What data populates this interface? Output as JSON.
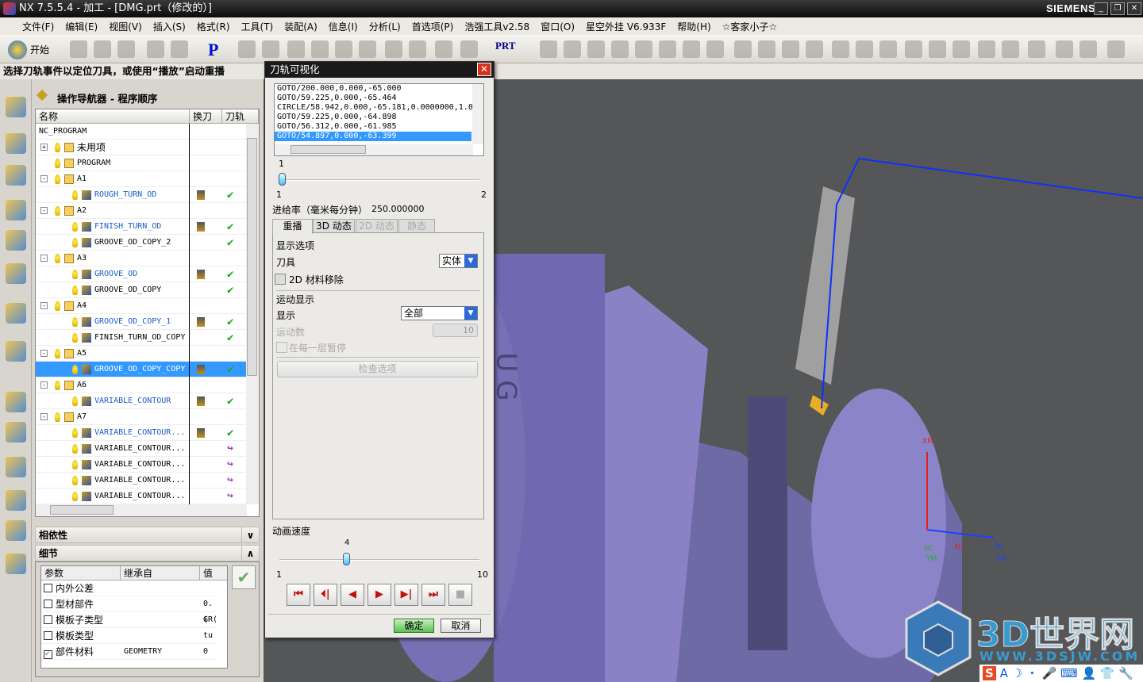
{
  "window": {
    "title": "NX 7.5.5.4 - 加工 - [DMG.prt（修改的）]",
    "brand": "SIEMENS"
  },
  "menu": [
    "文件(F)",
    "编辑(E)",
    "视图(V)",
    "插入(S)",
    "格式(R)",
    "工具(T)",
    "装配(A)",
    "信息(I)",
    "分析(L)",
    "首选项(P)",
    "浩强工具v2.58",
    "窗口(O)",
    "星空外挂 V6.933F",
    "帮助(H)",
    "☆客家小子☆"
  ],
  "toolbar": {
    "start_label": "开始",
    "prt_label": "PRT"
  },
  "cue": "选择刀轨事件以定位刀具，或使用“播放”启动重播",
  "navigator": {
    "title": "操作导航器 - 程序顺序",
    "columns": [
      "名称",
      "换刀",
      "刀轨"
    ],
    "rows": [
      {
        "name": "NC_PROGRAM",
        "level": 0,
        "type": "root"
      },
      {
        "name": "未用项",
        "level": 1,
        "type": "folder",
        "expander": "+"
      },
      {
        "name": "PROGRAM",
        "level": 1,
        "type": "folder"
      },
      {
        "name": "A1",
        "level": 1,
        "type": "folder",
        "expander": "-"
      },
      {
        "name": "ROUGH_TURN_OD",
        "level": 2,
        "type": "op",
        "blue": true,
        "tool": true,
        "status": "check"
      },
      {
        "name": "A2",
        "level": 1,
        "type": "folder",
        "expander": "-"
      },
      {
        "name": "FINISH_TURN_OD",
        "level": 2,
        "type": "op",
        "blue": true,
        "tool": true,
        "status": "check"
      },
      {
        "name": "GROOVE_OD_COPY_2",
        "level": 2,
        "type": "op",
        "status": "check"
      },
      {
        "name": "A3",
        "level": 1,
        "type": "folder",
        "expander": "-"
      },
      {
        "name": "GROOVE_OD",
        "level": 2,
        "type": "op",
        "blue": true,
        "tool": true,
        "status": "check"
      },
      {
        "name": "GROOVE_OD_COPY",
        "level": 2,
        "type": "op",
        "status": "check"
      },
      {
        "name": "A4",
        "level": 1,
        "type": "folder",
        "expander": "-"
      },
      {
        "name": "GROOVE_OD_COPY_1",
        "level": 2,
        "type": "op",
        "blue": true,
        "tool": true,
        "status": "check"
      },
      {
        "name": "FINISH_TURN_OD_COPY",
        "level": 2,
        "type": "op",
        "status": "check"
      },
      {
        "name": "A5",
        "level": 1,
        "type": "folder",
        "expander": "-"
      },
      {
        "name": "GROOVE_OD_COPY_COPY",
        "level": 2,
        "type": "op",
        "selected": true,
        "tool": true,
        "status": "check"
      },
      {
        "name": "A6",
        "level": 1,
        "type": "folder",
        "expander": "-"
      },
      {
        "name": "VARIABLE_CONTOUR",
        "level": 2,
        "type": "op",
        "blue": true,
        "tool": true,
        "status": "check"
      },
      {
        "name": "A7",
        "level": 1,
        "type": "folder",
        "expander": "-"
      },
      {
        "name": "VARIABLE_CONTOUR...",
        "level": 2,
        "type": "op",
        "blue": true,
        "tool": true,
        "status": "check"
      },
      {
        "name": "VARIABLE_CONTOUR...",
        "level": 2,
        "type": "op",
        "status": "regen"
      },
      {
        "name": "VARIABLE_CONTOUR...",
        "level": 2,
        "type": "op",
        "status": "regen"
      },
      {
        "name": "VARIABLE_CONTOUR...",
        "level": 2,
        "type": "op",
        "status": "regen"
      },
      {
        "name": "VARIABLE_CONTOUR...",
        "level": 2,
        "type": "op",
        "status": "regen"
      }
    ],
    "dependencies_label": "相依性",
    "details_label": "细节",
    "details_columns": [
      "参数",
      "继承自",
      "值"
    ],
    "details_rows": [
      {
        "param": "内外公差",
        "from": "",
        "value": "",
        "checked": false
      },
      {
        "param": "型材部件",
        "from": "",
        "value": "0.(",
        "checked": false
      },
      {
        "param": "模板子类型",
        "from": "",
        "value": "GR(",
        "checked": false
      },
      {
        "param": "模板类型",
        "from": "",
        "value": "tu",
        "checked": false
      },
      {
        "param": "部件材料",
        "from": "GEOMETRY",
        "value": "0",
        "checked": true
      }
    ]
  },
  "dialog": {
    "title": "刀轨可视化",
    "path_lines": [
      "GOTO/200.000,0.000,-65.000",
      "GOTO/59.225,0.000,-65.464",
      "CIRCLE/58.942,0.000,-65.181,0.0000000,1.0",
      "GOTO/59.225,0.000,-64.898",
      "GOTO/56.312,0.000,-61.985",
      "GOTO/54.897,0.000,-63.399"
    ],
    "selected_line": 5,
    "slider": {
      "value": "1",
      "min": "1",
      "max": "2"
    },
    "feedrate_label": "进给率（毫米每分钟）",
    "feedrate_value": "250.000000",
    "tabs": [
      "重播",
      "3D 动态",
      "2D 动态",
      "静态"
    ],
    "display_options_label": "显示选项",
    "tool_label": "刀具",
    "tool_value": "实体",
    "material_removal_label": "2D 材料移除",
    "motion_display_label": "运动显示",
    "display_label": "显示",
    "display_value": "全部",
    "motion_count_label": "运动数",
    "motion_count_value": "10",
    "pause_label": "在每一层暂停",
    "check_options_label": "检查选项",
    "speed_label": "动画速度",
    "speed": {
      "value": "4",
      "min": "1",
      "max": "10"
    },
    "ok_label": "确定",
    "cancel_label": "取消"
  },
  "viewport": {
    "part_letters": "UG",
    "axes": [
      "XC",
      "YC",
      "ZC",
      "XM",
      "YM",
      "ZM"
    ],
    "watermark": "3D世界网",
    "watermark_url": "WWW.3DSJW.COM"
  },
  "colors": {
    "part": "#7a70b0",
    "selection": "#3399ff",
    "viewport_bg": "#555658"
  }
}
